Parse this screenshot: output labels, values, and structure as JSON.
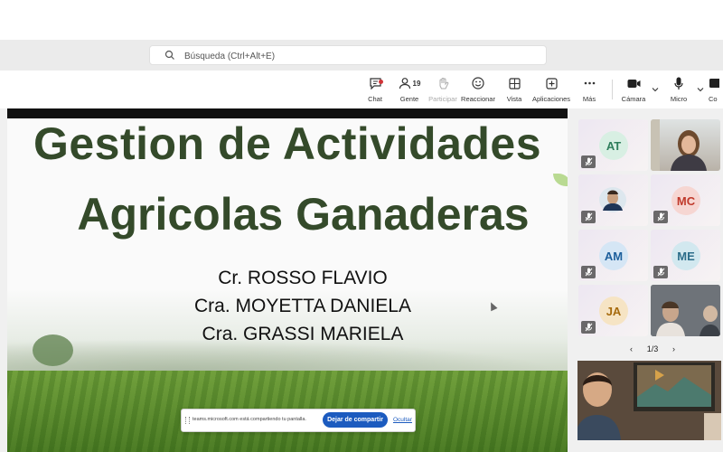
{
  "search": {
    "placeholder": "Búsqueda (Ctrl+Alt+E)"
  },
  "toolbar": {
    "chat": "Chat",
    "people": "Gente",
    "people_count": "19",
    "raise": "Participar",
    "react": "Reaccionar",
    "view": "Vista",
    "apps": "Aplicaciones",
    "more": "Más",
    "camera": "Cámara",
    "mic": "Micro",
    "share_partial": "Co"
  },
  "slide": {
    "title_line1": "Gestion de Actividades",
    "title_line2": "Agricolas Ganaderas",
    "authors": [
      "Cr. ROSSO FLAVIO",
      "Cra. MOYETTA DANIELA",
      "Cra. GRASSI MARIELA"
    ]
  },
  "share_banner": {
    "message": "teams.microsoft.com está compartiendo tu pantalla.",
    "stop": "Dejar de compartir",
    "hide": "Ocultar"
  },
  "participants": [
    {
      "initials": "AT",
      "color": "#2e7d5b",
      "bg": "#d8efe3"
    },
    {
      "initials": "MC",
      "color": "#c0392b",
      "bg": "#f6d6d2"
    },
    {
      "initials": "AM",
      "color": "#1d5f9c",
      "bg": "#d5e6f5"
    },
    {
      "initials": "ME",
      "color": "#2c6d8a",
      "bg": "#d2e8ef"
    },
    {
      "initials": "JA",
      "color": "#a66a0c",
      "bg": "#f6e4c4"
    }
  ],
  "pager": {
    "text": "1/3"
  },
  "colors": {
    "accent": "#1c5bbf",
    "title_green": "#344a2a"
  }
}
